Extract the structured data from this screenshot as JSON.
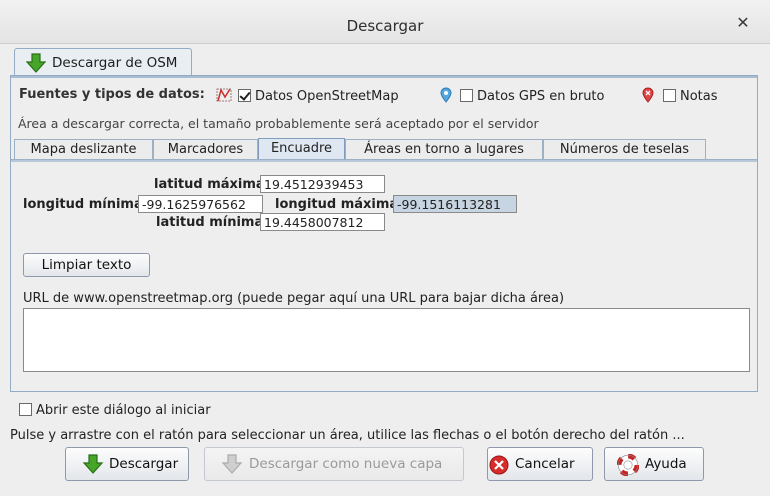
{
  "window": {
    "title": "Descargar",
    "close_icon": "close-icon"
  },
  "outer_tab": {
    "label": "Descargar de OSM",
    "icon": "download-arrow-icon"
  },
  "sources": {
    "label": "Fuentes y tipos de datos:",
    "items": [
      {
        "icon": "osm-data-icon",
        "checked": true,
        "label": "Datos OpenStreetMap"
      },
      {
        "icon": "gps-marker-icon",
        "checked": false,
        "label": "Datos GPS en bruto"
      },
      {
        "icon": "notes-marker-icon",
        "checked": false,
        "label": "Notas"
      }
    ]
  },
  "status_text": "Área a descargar correcta, el tamaño probablemente será aceptado por el servidor",
  "inner_tabs": [
    {
      "label": "Mapa deslizante",
      "active": false
    },
    {
      "label": "Marcadores",
      "active": false
    },
    {
      "label": "Encuadre",
      "active": true
    },
    {
      "label": "Áreas en torno a lugares",
      "active": false
    },
    {
      "label": "Números de teselas",
      "active": false
    }
  ],
  "bbox": {
    "lat_max_label": "latitud máxima",
    "lat_max": "19.4512939453",
    "lon_min_label": "longitud mínima",
    "lon_min": "-99.1625976562",
    "lon_max_label": "longitud máxima",
    "lon_max": "-99.1516113281",
    "lat_min_label": "latitud mínima",
    "lat_min": "19.4458007812"
  },
  "clear_button": "Limpiar texto",
  "url": {
    "label": "URL de www.openstreetmap.org (puede pegar aquí una URL para bajar dicha área)",
    "value": ""
  },
  "open_on_start": {
    "checked": false,
    "label": "Abrir este diálogo al iniciar"
  },
  "hint": "Pulse y arrastre con el ratón para seleccionar un área, utilice las flechas o el botón derecho del ratón ...",
  "buttons": {
    "download": "Descargar",
    "download_new_layer": "Descargar como nueva capa",
    "cancel": "Cancelar",
    "help": "Ayuda"
  },
  "colors": {
    "accent": "#93abc4",
    "download_green": "#3fa12a",
    "cancel_red": "#d32a2a"
  }
}
